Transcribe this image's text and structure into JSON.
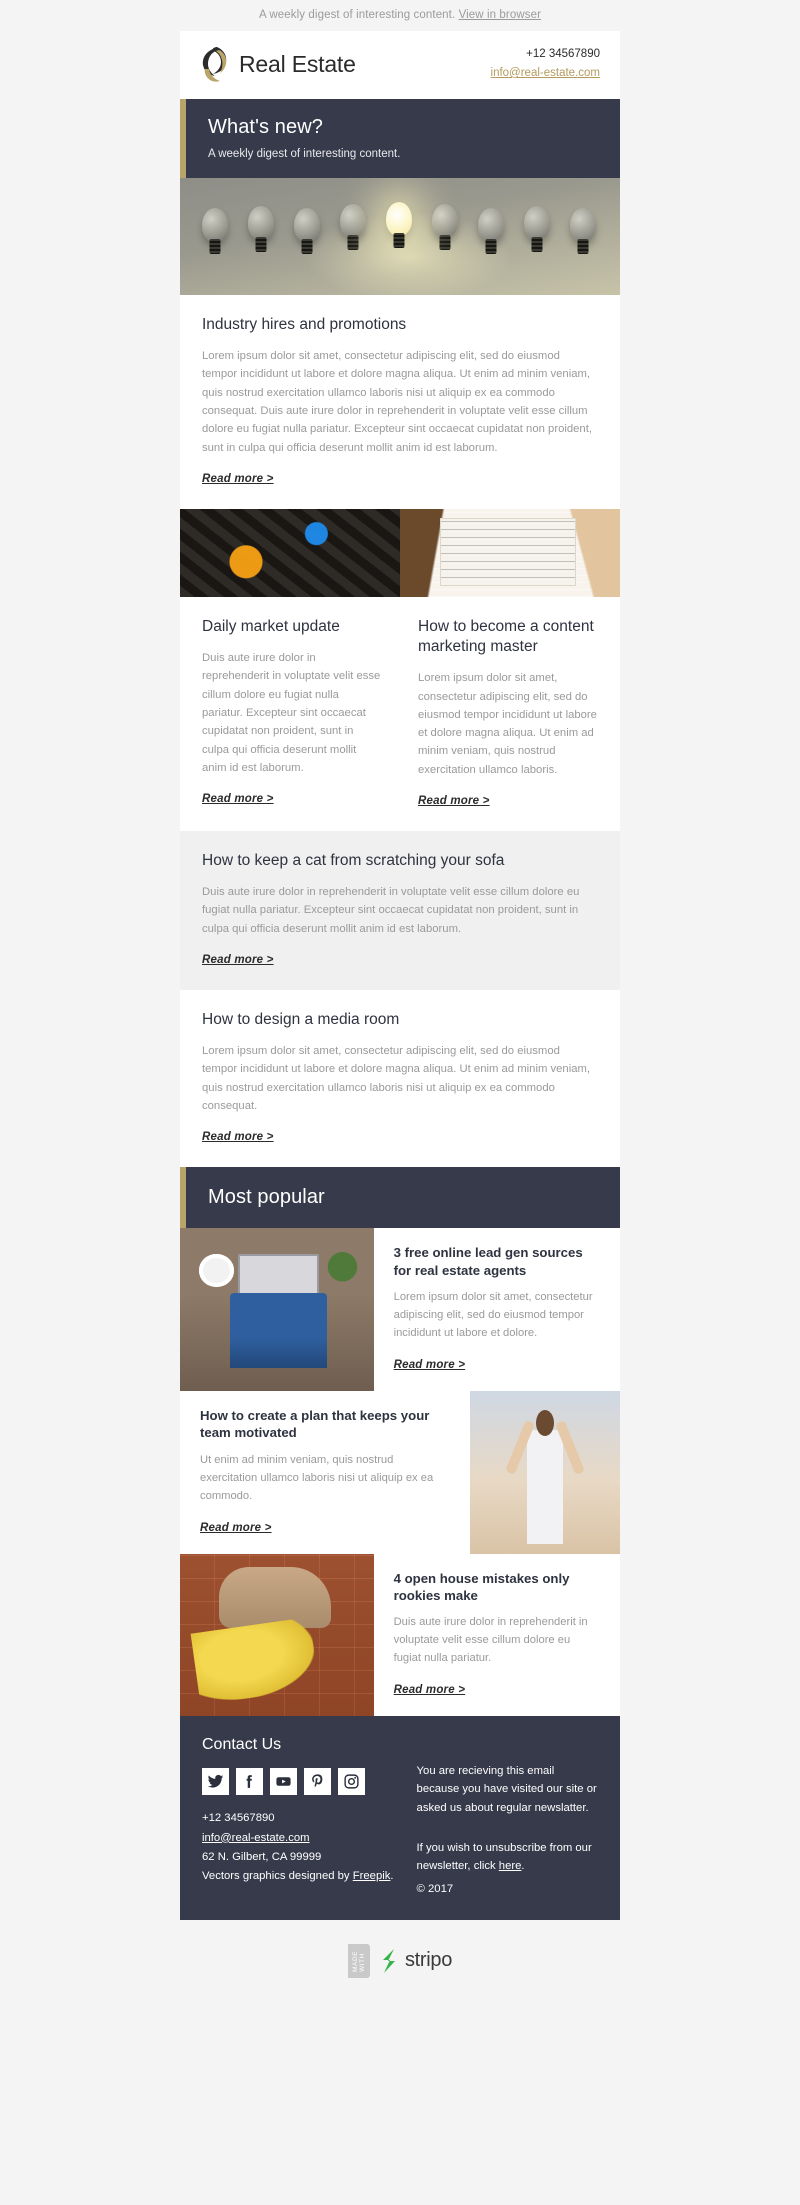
{
  "preheader": {
    "text": "A weekly digest of interesting content.",
    "link": "View in browser"
  },
  "brand": {
    "name": "Real Estate",
    "logo_icon": "real-estate-swirl-logo",
    "phone": "+12 34567890",
    "email": "info@real-estate.com"
  },
  "hero_banner": {
    "title": "What's new?",
    "subtitle": "A weekly digest of interesting content.",
    "image_icon": "lightbulbs-row-image",
    "accent_color": "#b9a46a",
    "background_color": "#363a4a"
  },
  "articles": [
    {
      "title": "Industry hires and promotions",
      "body": "Lorem ipsum dolor sit amet, consectetur adipiscing elit, sed do eiusmod tempor incididunt ut labore et dolore magna aliqua. Ut enim ad minim veniam, quis nostrud exercitation ullamco laboris nisi ut aliquip ex ea commodo consequat. Duis aute irure dolor in reprehenderit in voluptate velit esse cillum dolore eu fugiat nulla pariatur. Excepteur sint occaecat cupidatat non proident, sunt in culpa qui officia deserunt mollit anim id est laborum.",
      "read_more": "Read more >"
    }
  ],
  "two_column": {
    "left": {
      "image_icon": "orange-question-mark-letters-image",
      "title": "Daily market update",
      "body": "Duis aute irure dolor in reprehenderit in voluptate velit esse cillum dolore eu fugiat nulla pariatur. Excepteur sint occaecat cupidatat non proident, sunt in culpa qui officia deserunt mollit anim id est laborum.",
      "read_more": "Read more >"
    },
    "right": {
      "image_icon": "notebook-planning-image",
      "title": "How to become a content marketing master",
      "body": "Lorem ipsum dolor sit amet, consectetur adipiscing elit, sed do eiusmod tempor incididunt ut labore et dolore magna aliqua. Ut enim ad minim veniam, quis nostrud exercitation ullamco laboris.",
      "read_more": "Read more >"
    }
  },
  "articles_2": [
    {
      "title": "How to keep a cat from scratching your sofa",
      "body": "Duis aute irure dolor in reprehenderit in voluptate velit esse cillum dolore eu fugiat nulla pariatur. Excepteur sint occaecat cupidatat non proident, sunt in culpa qui officia deserunt mollit anim id est laborum.",
      "read_more": "Read more >"
    },
    {
      "title": "How to design a media room",
      "body": "Lorem ipsum dolor sit amet, consectetur adipiscing elit, sed do eiusmod tempor incididunt ut labore et dolore magna aliqua. Ut enim ad minim veniam, quis nostrud exercitation ullamco laboris nisi ut aliquip ex ea commodo consequat.",
      "read_more": "Read more >"
    }
  ],
  "most_popular": {
    "heading": "Most popular",
    "cards": [
      {
        "image_icon": "laptop-desk-overhead-image",
        "title": "3 free online lead gen sources for real estate agents",
        "body": "Lorem ipsum dolor sit amet, consectetur adipiscing elit, sed do eiusmod tempor incididunt ut labore et dolore.",
        "read_more": "Read more >"
      },
      {
        "image_icon": "woman-arms-raised-image",
        "title": "How to create a plan that keeps your team motivated",
        "body": "Ut enim ad minim veniam, quis nostrud exercitation ullamco laboris nisi ut aliquip ex ea commodo.",
        "read_more": "Read more >"
      },
      {
        "image_icon": "shoe-banana-peel-image",
        "title": "4 open house mistakes only rookies make",
        "body": "Duis aute irure dolor in reprehenderit in voluptate velit esse cillum dolore eu fugiat nulla pariatur.",
        "read_more": "Read more >"
      }
    ]
  },
  "footer": {
    "title": "Contact Us",
    "socials": [
      {
        "name": "twitter-icon",
        "label": "Twitter"
      },
      {
        "name": "facebook-icon",
        "label": "Facebook"
      },
      {
        "name": "youtube-icon",
        "label": "YouTube"
      },
      {
        "name": "pinterest-icon",
        "label": "Pinterest"
      },
      {
        "name": "instagram-icon",
        "label": "Instagram"
      }
    ],
    "phone": "+12 34567890",
    "email": "info@real-estate.com",
    "address": "62 N. Gilbert, CA 99999",
    "credit_prefix": "Vectors graphics designed by ",
    "credit_link": "Freepik",
    "credit_suffix": ".",
    "note_1": "You are recieving this email because you have visited our site or asked us about regular newslatter.",
    "note_2_prefix": "If you wish to unsubscribe from our newsletter, click ",
    "note_2_link": "here",
    "note_2_suffix": ".",
    "copyright": "© 2017"
  },
  "stripo": {
    "made_with": "MADE WITH",
    "brand": "stripo",
    "logo_icon": "stripo-logo",
    "accent_color": "#36b44a"
  }
}
